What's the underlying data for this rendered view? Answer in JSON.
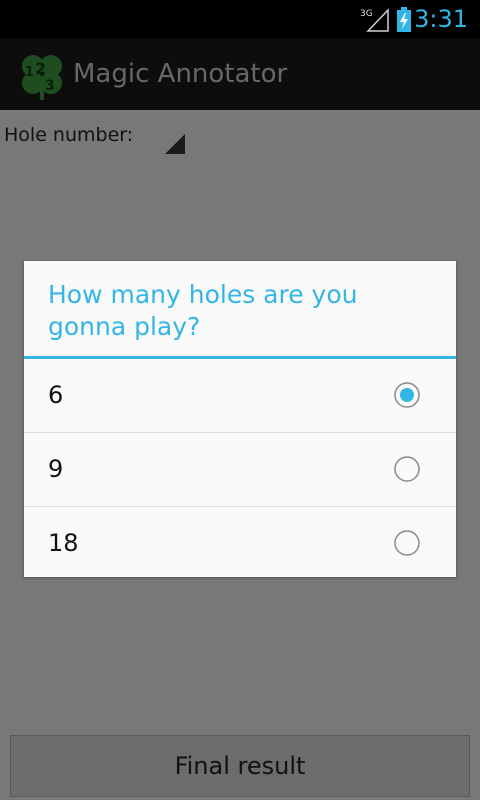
{
  "status_bar": {
    "network": "3G",
    "time": "3:31",
    "accent_color": "#33b5e5"
  },
  "app": {
    "title": "Magic Annotator",
    "logo_icon": "clover-123-logo-icon"
  },
  "form": {
    "hole_label": "Hole number:",
    "final_button_label": "Final result"
  },
  "dialog": {
    "title": "How many holes are you gonna play?",
    "options": [
      {
        "label": "6",
        "selected": true
      },
      {
        "label": "9",
        "selected": false
      },
      {
        "label": "18",
        "selected": false
      }
    ]
  }
}
